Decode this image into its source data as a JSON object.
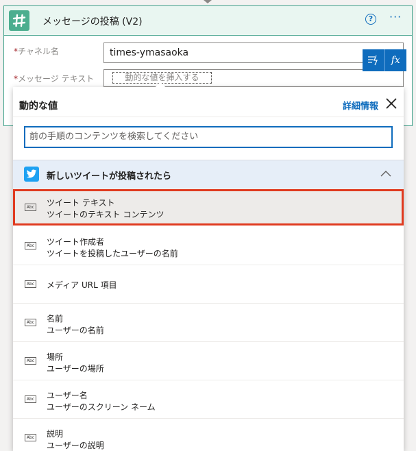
{
  "action_card": {
    "title": "メッセージの投稿 (V2)",
    "icons": {
      "app": "slack-icon",
      "help": "help-circle-icon",
      "more": "more-ellipsis-icon"
    },
    "help_glyph": "?",
    "more_glyph": "···",
    "fields": [
      {
        "label": "チャネル名",
        "required": true,
        "value": "times-ymasaoka"
      },
      {
        "label": "メッセージ テキスト",
        "required": true,
        "token_placeholder": "動的な値を挿入する"
      }
    ],
    "expression_tabs": [
      {
        "icon": "dynamic-content-icon"
      },
      {
        "label": "fx",
        "icon": "expression-fx-icon"
      }
    ]
  },
  "dynamic_panel": {
    "title": "動的な値",
    "details_link": "詳細情報",
    "search_placeholder": "前の手順のコンテンツを検索してください",
    "group": {
      "title": "新しいツイートが投稿されたら",
      "icon": "twitter-icon",
      "expanded": true
    },
    "items": [
      {
        "type_icon": "Abc",
        "title": "ツイート テキスト",
        "description": "ツイートのテキスト コンテンツ",
        "selected": true
      },
      {
        "type_icon": "Abc",
        "title": "ツイート作成者",
        "description": "ツイートを投稿したユーザーの名前",
        "selected": false
      },
      {
        "type_icon": "Abc",
        "title": "メディア URL 項目",
        "description": "",
        "selected": false
      },
      {
        "type_icon": "Abc",
        "title": "名前",
        "description": "ユーザーの名前",
        "selected": false
      },
      {
        "type_icon": "Abc",
        "title": "場所",
        "description": "ユーザーの場所",
        "selected": false
      },
      {
        "type_icon": "Abc",
        "title": "ユーザー名",
        "description": "ユーザーのスクリーン ネーム",
        "selected": false
      },
      {
        "type_icon": "Abc",
        "title": "説明",
        "description": "ユーザーの説明",
        "selected": false
      }
    ]
  },
  "colors": {
    "accent": "#0f6cbd",
    "connector_border": "#3fa18a",
    "header_bg": "#e9f6f1",
    "group_bg": "#e6eef8",
    "selection_outline": "#e03a1f",
    "required": "#a4262c"
  }
}
